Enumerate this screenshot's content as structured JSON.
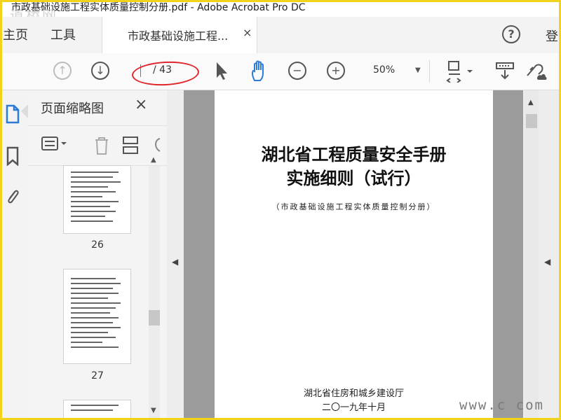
{
  "window": {
    "title": "市政基础设施工程实体质量控制分册.pdf - Adobe Acrobat Pro DC",
    "watermark_top_left": "道桥网",
    "watermark_bottom_right": "www.c   com"
  },
  "tabs": {
    "home": "主页",
    "tools": "工具",
    "doc_tab": "市政基础设施工程...",
    "close_glyph": "×",
    "help_glyph": "?",
    "login": "登"
  },
  "toolbar": {
    "page_current": "",
    "page_total": "/ 43",
    "zoom": "50%",
    "annotation_color": "#e0262a"
  },
  "panel": {
    "title": "页面缩略图",
    "close_glyph": "×",
    "thumbnails": [
      {
        "label": "26"
      },
      {
        "label": "27"
      }
    ]
  },
  "document": {
    "title_line1": "湖北省工程质量安全手册",
    "title_line2": "实施细则（试行）",
    "subtitle": "（市政基础设施工程实体质量控制分册）",
    "organization": "湖北省住房和城乡建设厅",
    "date": "二〇一九年十月"
  },
  "colors": {
    "frame": "#f2d21a",
    "accent_blue": "#2a7cd8"
  }
}
